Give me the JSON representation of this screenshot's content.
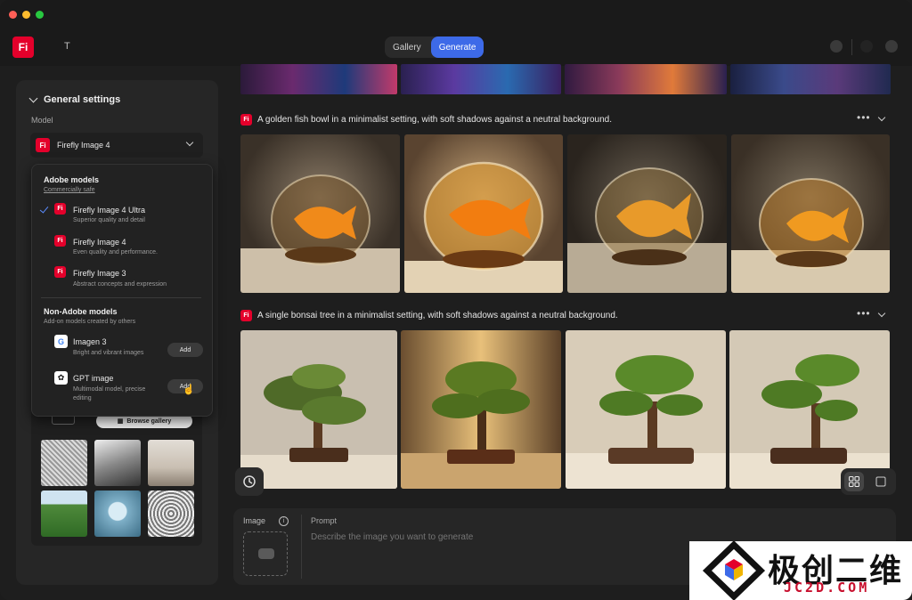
{
  "app": {
    "name": "T",
    "logo": "Fi"
  },
  "header": {
    "tabs": [
      {
        "label": "Gallery",
        "active": false
      },
      {
        "label": "Generate",
        "active": true
      }
    ]
  },
  "settings": {
    "title": "General settings",
    "model_label": "Model",
    "selected_model": "Firefly Image 4",
    "dropdown": {
      "adobe_heading": "Adobe models",
      "adobe_sub": "Commercially safe",
      "adobe_models": [
        {
          "name": "Firefly Image 4 Ultra",
          "desc": "Superior quality and detail",
          "selected": true
        },
        {
          "name": "Firefly Image 4",
          "desc": "Even quality and performance.",
          "selected": false
        },
        {
          "name": "Firefly Image 3",
          "desc": "Abstract concepts and expression",
          "selected": false
        }
      ],
      "non_adobe_heading": "Non-Adobe models",
      "non_adobe_sub": "Add-on models created by others",
      "non_adobe_models": [
        {
          "name": "Imagen 3",
          "desc": "Bright and vibrant images",
          "button": "Add",
          "icon": "google-icon"
        },
        {
          "name": "GPT image",
          "desc": "Multimodal model, precise editing",
          "button": "Add",
          "icon": "openai-icon"
        }
      ]
    },
    "browse_gallery": "Browse gallery"
  },
  "generations": [
    {
      "prompt": "A golden fish bowl in a minimalist setting, with soft shadows against a neutral background."
    },
    {
      "prompt": "A single bonsai tree in a minimalist setting, with soft shadows against a neutral background."
    }
  ],
  "composer": {
    "image_label": "Image",
    "prompt_label": "Prompt",
    "prompt_placeholder": "Describe the image you want to generate"
  },
  "watermark": {
    "zh": "极创二维",
    "en": "JC2D.COM"
  },
  "colors": {
    "accent": "#3d6ae8",
    "brand": "#e4002b"
  }
}
